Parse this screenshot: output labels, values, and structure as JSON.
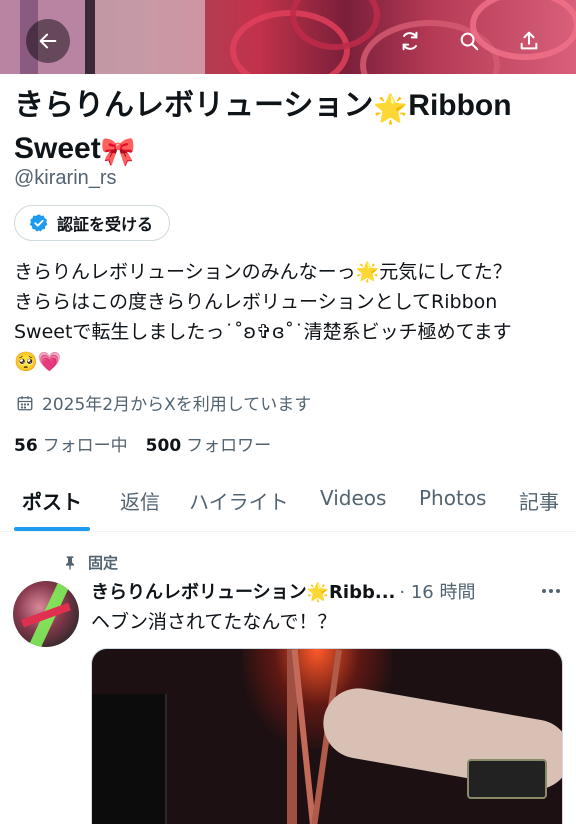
{
  "header": {
    "back_icon": "arrow-left-icon",
    "refresh_icon": "refresh-icon",
    "search_icon": "search-icon",
    "share_icon": "share-icon"
  },
  "profile": {
    "name_part1": "きらりんレボリューション",
    "name_emoji1": "🌟",
    "name_part2": "Ribbon Sweet",
    "name_emoji2": "🎀",
    "handle": "@kirarin_rs",
    "verify_button": "認証を受ける",
    "bio_line1": "きらりんレボリューションのみんなーっ🌟元気にしてた？",
    "bio_line2": "きららはこの度きらりんレボリューションとしてRibbon",
    "bio_line3": "Sweetで転生しましたっ˙˚ʚ✞ɞ˚˙清楚系ビッチ極めてます",
    "bio_line4": "🥺💗",
    "joined": "2025年2月からXを利用しています",
    "following_count": "56",
    "following_label": "フォロー中",
    "followers_count": "500",
    "followers_label": "フォロワー"
  },
  "tabs": [
    "ポスト",
    "返信",
    "ハイライト",
    "Videos",
    "Photos",
    "記事"
  ],
  "pinned_post": {
    "pinned_label": "固定",
    "author": "きらりんレボリューション🌟Ribb...",
    "time": "· 16 時間",
    "text": "ヘブン消されてたなんで！？"
  },
  "colors": {
    "accent": "#1d9bf0",
    "text_primary": "#0f1419",
    "text_secondary": "#536471",
    "verify_badge": "#1d9bf0"
  }
}
